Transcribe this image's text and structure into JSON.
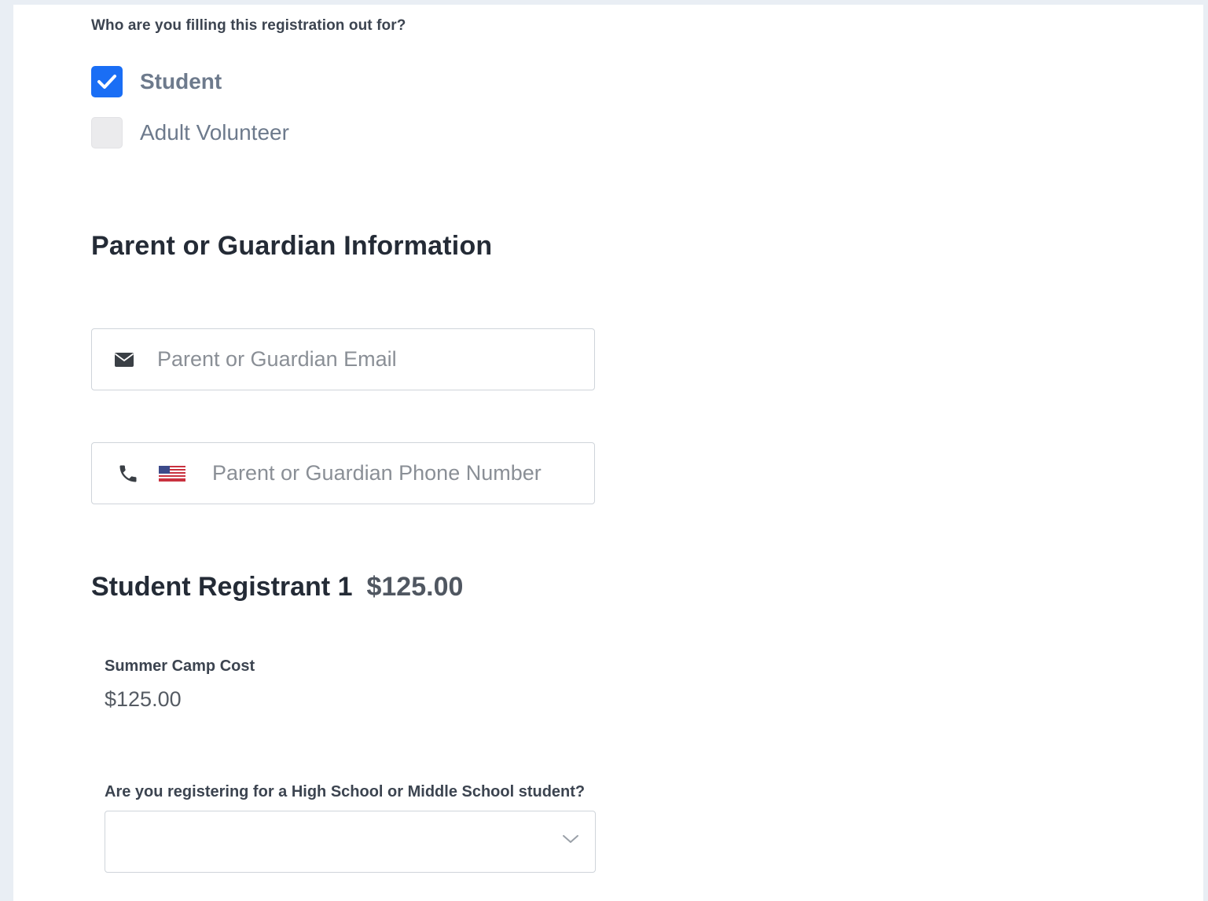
{
  "registration_for": {
    "question": "Who are you filling this registration out for?",
    "options": [
      {
        "label": "Student",
        "checked": true
      },
      {
        "label": "Adult Volunteer",
        "checked": false
      }
    ]
  },
  "parent_section": {
    "title": "Parent or Guardian Information",
    "email_field": {
      "placeholder": "Parent or Guardian Email",
      "value": ""
    },
    "phone_field": {
      "placeholder": "Parent or Guardian Phone Number",
      "value": "",
      "country": "us-flag"
    }
  },
  "registrant": {
    "title": "Student Registrant 1",
    "price": "$125.00",
    "cost_label": "Summer Camp Cost",
    "cost_value": "$125.00",
    "school_question": "Are you registering for a High School or Middle School student?",
    "school_selected": ""
  },
  "colors": {
    "accent": "#1a6ef5",
    "background": "#e9eef4",
    "heading": "#242b36"
  },
  "icons": [
    "checkmark-icon",
    "envelope-icon",
    "phone-icon",
    "us-flag-icon",
    "chevron-down-icon"
  ]
}
